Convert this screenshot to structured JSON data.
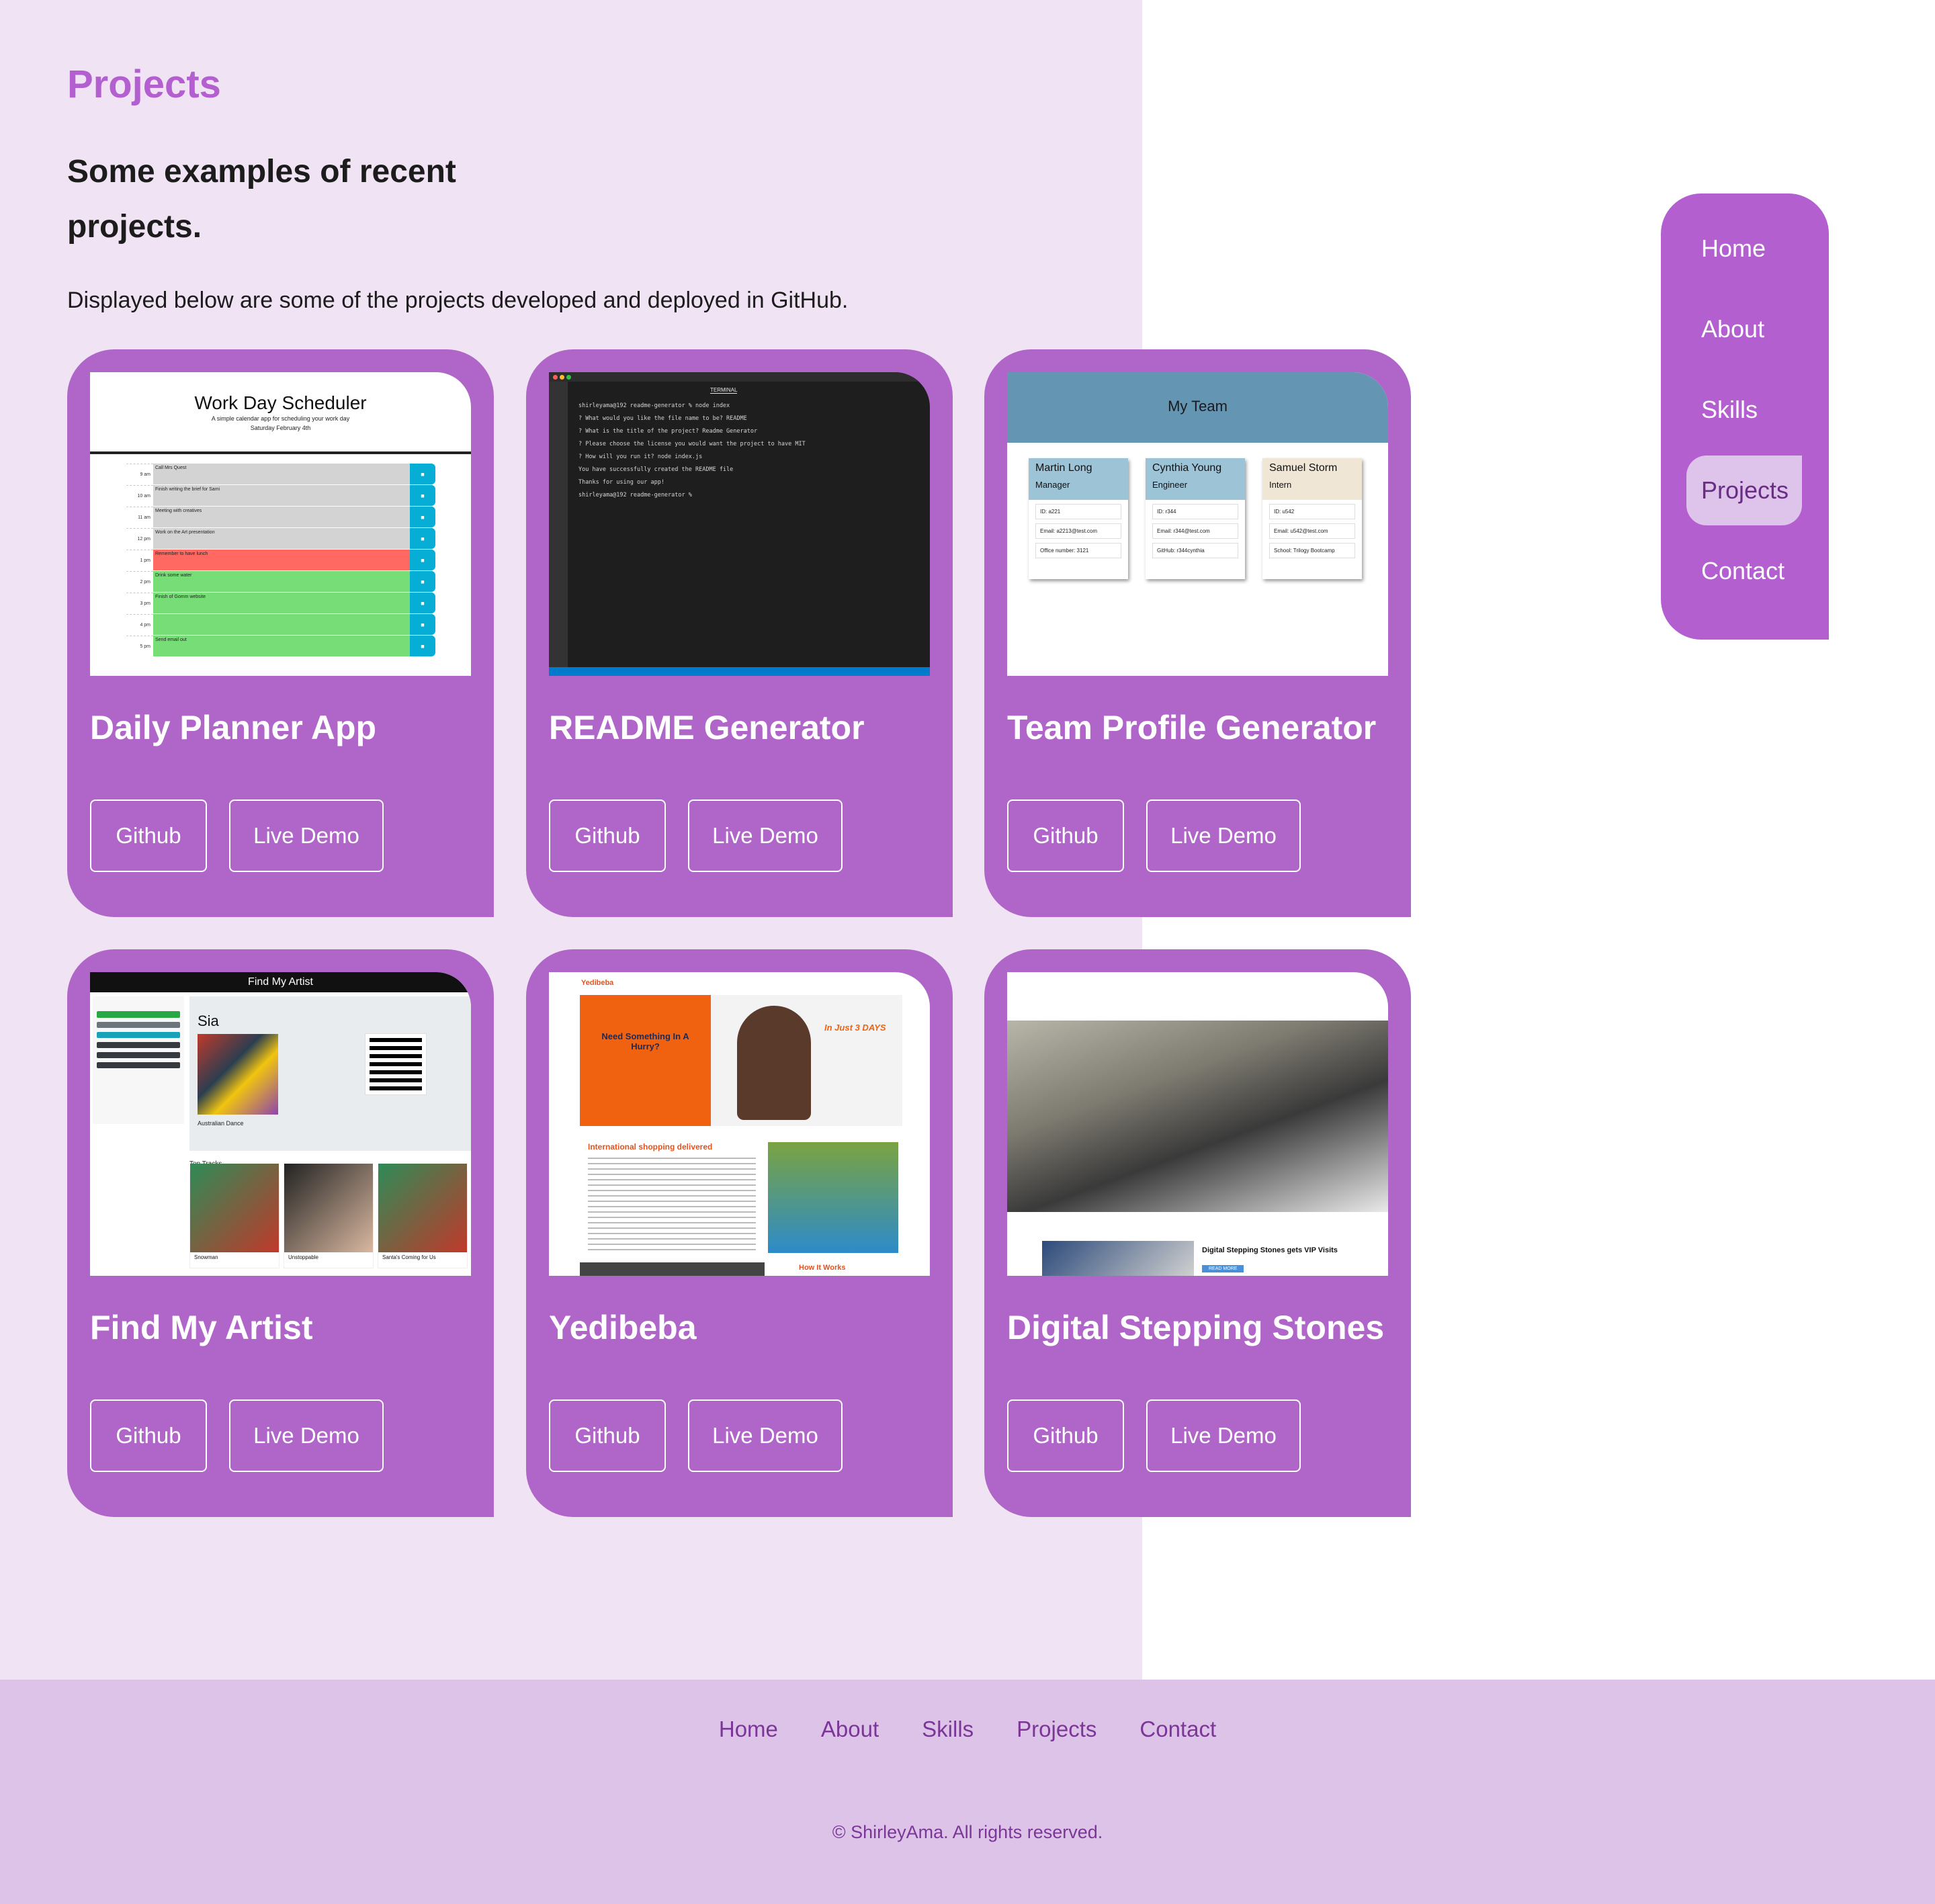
{
  "header": {
    "title": "Projects",
    "subtitle": "Some examples of recent projects.",
    "intro": "Displayed below are some of the projects developed and deployed in GitHub."
  },
  "nav": {
    "items": [
      {
        "label": "Home",
        "active": false
      },
      {
        "label": "About",
        "active": false
      },
      {
        "label": "Skills",
        "active": false
      },
      {
        "label": "Projects",
        "active": true
      },
      {
        "label": "Contact",
        "active": false
      }
    ]
  },
  "projects": [
    {
      "title": "Daily Planner App",
      "github_label": "Github",
      "demo_label": "Live Demo"
    },
    {
      "title": "README Generator",
      "github_label": "Github",
      "demo_label": "Live Demo"
    },
    {
      "title": "Team Profile Generator",
      "github_label": "Github",
      "demo_label": "Live Demo"
    },
    {
      "title": "Find My Artist",
      "github_label": "Github",
      "demo_label": "Live Demo"
    },
    {
      "title": "Yedibeba",
      "github_label": "Github",
      "demo_label": "Live Demo"
    },
    {
      "title": "Digital Stepping Stones",
      "github_label": "Github",
      "demo_label": "Live Demo"
    }
  ],
  "previews": {
    "planner": {
      "heading": "Work Day Scheduler",
      "sub": "A simple calendar app for scheduling your work day",
      "date": "Saturday February 4th",
      "hours": [
        "9 am",
        "10 am",
        "11 am",
        "12 pm",
        "1 pm",
        "2 pm",
        "3 pm",
        "4 pm",
        "5 pm"
      ],
      "tasks": [
        "Call Mrs Quest",
        "Finish writing the brief for Sami",
        "Meeting with creatives",
        "Work on the Art presentation",
        "Remember to have lunch",
        "Drink some water",
        "Finish of Gomm website",
        "",
        "Send email out"
      ]
    },
    "readme": {
      "tab": "TERMINAL",
      "lines": [
        "shirleyama@192 readme-generator % node index",
        "? What would you like the file name to be? README",
        "? What is the title of the project? Readme Generator",
        "? Please choose the license you would want the project to have MIT",
        "? How will you run it? node index.js",
        "You have successfully created the README file",
        "Thanks for using our app!",
        "shirleyama@192 readme-generator %"
      ]
    },
    "team": {
      "heading": "My Team",
      "members": [
        {
          "name": "Martin Long",
          "role": "Manager",
          "id": "ID: a221",
          "email": "Email: a2213@test.com",
          "extra": "Office number: 3121"
        },
        {
          "name": "Cynthia Young",
          "role": "Engineer",
          "id": "ID: r344",
          "email": "Email: r344@test.com",
          "extra": "GitHub: r344cynthia"
        },
        {
          "name": "Samuel Storm",
          "role": "Intern",
          "id": "ID: u542",
          "email": "Email: u542@test.com",
          "extra": "School: Trilogy Bootcamp"
        }
      ]
    },
    "artist": {
      "heading": "Find My Artist",
      "artist": "Sia",
      "genre": "Australian Dance",
      "top_tracks": "Top Tracks",
      "tracks": [
        "Snowman",
        "Unstoppable",
        "Santa's Coming for Us"
      ]
    },
    "yedibeba": {
      "brand": "Yedibeba",
      "hero": "Need Something In A Hurry?",
      "badge": "In Just 3 DAYS",
      "section": "International shopping delivered",
      "how": "How It Works"
    },
    "dss": {
      "headline": "Digital Stepping Stones gets VIP Visits",
      "button": "READ MORE"
    }
  },
  "footer": {
    "links": [
      "Home",
      "About",
      "Skills",
      "Projects",
      "Contact"
    ],
    "copyright": "© ShirleyAma. All rights reserved."
  },
  "colors": {
    "accent": "#b35fd0",
    "card": "#b066c9",
    "left_bg": "#f0e3f3",
    "footer_bg": "#ddc3e8"
  }
}
